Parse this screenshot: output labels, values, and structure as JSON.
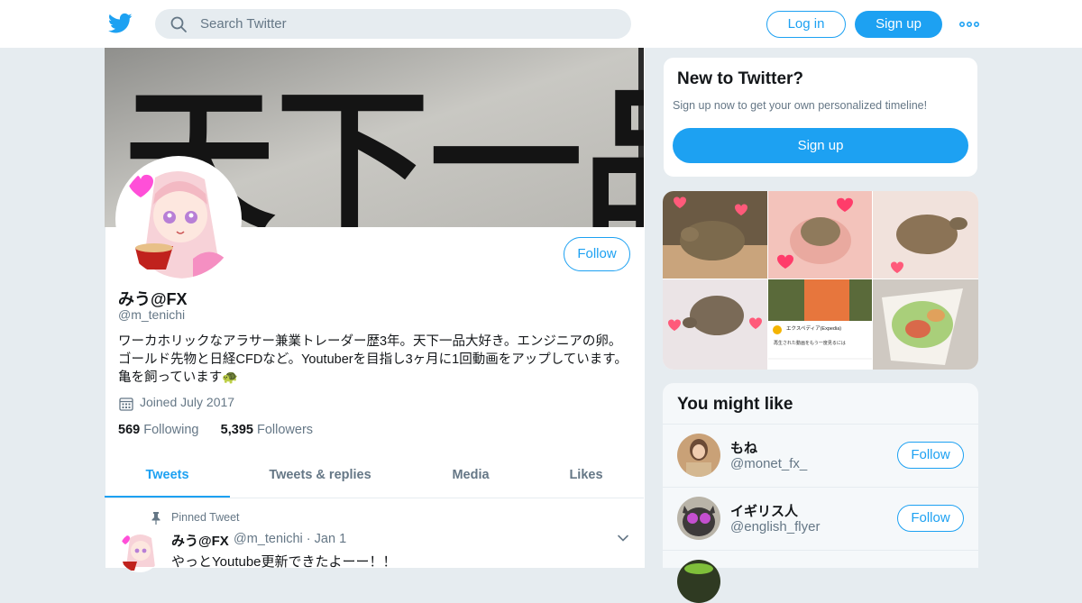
{
  "header": {
    "search_placeholder": "Search Twitter",
    "login_label": "Log in",
    "signup_label": "Sign up",
    "brand_color": "#1da1f2"
  },
  "profile": {
    "follow_label": "Follow",
    "name": "みう@FX",
    "handle": "@m_tenichi",
    "bio": "ワーカホリックなアラサー兼業トレーダー歴3年。天下一品大好き。エンジニアの卵。ゴールド先物と日経CFDなど。Youtuberを目指し3ヶ月に1回動画をアップしています。亀を飼っています🐢",
    "joined": "Joined July 2017",
    "following_count": "569",
    "following_label": "Following",
    "followers_count": "5,395",
    "followers_label": "Followers",
    "banner_text": "天下一品"
  },
  "tabs": [
    {
      "label": "Tweets",
      "active": true
    },
    {
      "label": "Tweets & replies",
      "active": false
    },
    {
      "label": "Media",
      "active": false
    },
    {
      "label": "Likes",
      "active": false
    }
  ],
  "pinned_tweet": {
    "pinned_label": "Pinned Tweet",
    "name": "みう@FX",
    "handle_date": "@m_tenichi · Jan 1",
    "text": "やっとYoutube更新できたよーー！！"
  },
  "new_to_twitter": {
    "title": "New to Twitter?",
    "subtitle": "Sign up now to get your own personalized timeline!",
    "signup_label": "Sign up"
  },
  "media_tile_text": {
    "line1": "エクスペディア(Expedia)",
    "line2": "再生された動画をもう一度見るには"
  },
  "you_might_like": {
    "title": "You might like",
    "items": [
      {
        "name": "もね",
        "handle": "@monet_fx_",
        "follow_label": "Follow"
      },
      {
        "name": "イギリス人",
        "handle": "@english_flyer",
        "follow_label": "Follow"
      }
    ]
  }
}
